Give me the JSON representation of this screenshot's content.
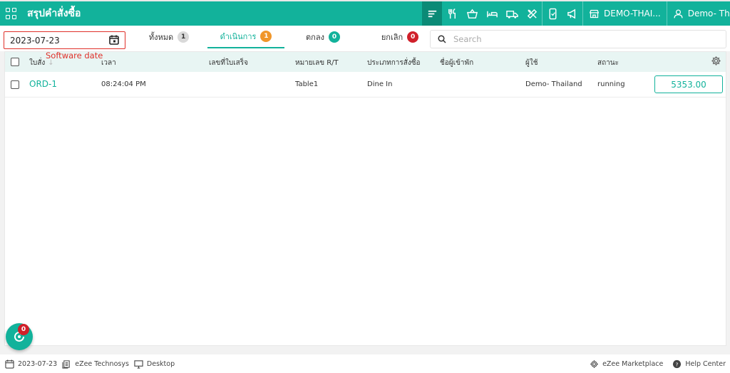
{
  "header": {
    "title": "สรุปคำสั่งซื้อ",
    "outlet": "DEMO-THAI...",
    "user": "Demo- Thail..."
  },
  "filter": {
    "date": "2023-07-23",
    "annotation": "Software date",
    "tabs": [
      {
        "label": "ทั้งหมด",
        "count": "1",
        "color": "#d9d9d9",
        "text_color": "#333"
      },
      {
        "label": "ดำเนินการ",
        "count": "1",
        "color": "#f0962a",
        "text_color": "#fff"
      },
      {
        "label": "ตกลง",
        "count": "0",
        "color": "#12b29b",
        "text_color": "#fff"
      },
      {
        "label": "ยกเลิก",
        "count": "0",
        "color": "#d0202a",
        "text_color": "#fff"
      }
    ],
    "search_placeholder": "Search"
  },
  "table": {
    "columns": [
      "ใบสั่ง",
      "เวลา",
      "เลขที่ใบเสร็จ",
      "หมายเลข R/T",
      "ประเภทการสั่งซื้อ",
      "ชื่อผู้เข้าพัก",
      "ผู้ใช้",
      "สถานะ"
    ],
    "rows": [
      {
        "order": "ORD-1",
        "time": "08:24:04 PM",
        "receipt": "",
        "rt": "Table1",
        "type": "Dine In",
        "guest": "",
        "user": "Demo- Thailand",
        "status": "running",
        "amount": "5353.00"
      }
    ]
  },
  "fab": {
    "badge": "0"
  },
  "footer": {
    "date": "2023-07-23",
    "company": "eZee Technosys",
    "mode": "Desktop",
    "marketplace": "eZee Marketplace",
    "help": "Help Center"
  },
  "colors": {
    "accent": "#12b29b",
    "accent_dark": "#0b8a76",
    "annotation": "#e0302a"
  }
}
